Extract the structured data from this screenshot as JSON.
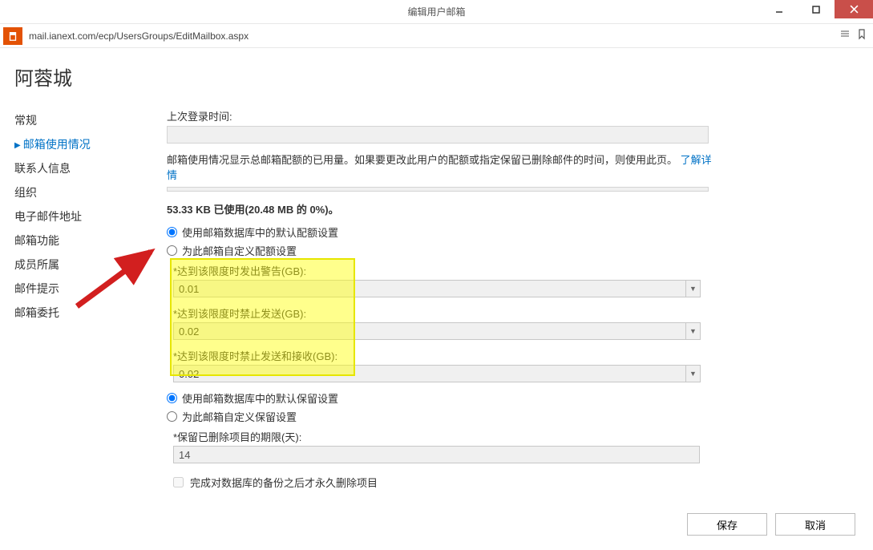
{
  "window": {
    "title": "编辑用户邮箱"
  },
  "addressbar": {
    "url": "mail.ianext.com/ecp/UsersGroups/EditMailbox.aspx"
  },
  "heading": "阿蓉城",
  "nav": {
    "items": [
      {
        "label": "常规"
      },
      {
        "label": "邮箱使用情况"
      },
      {
        "label": "联系人信息"
      },
      {
        "label": "组织"
      },
      {
        "label": "电子邮件地址"
      },
      {
        "label": "邮箱功能"
      },
      {
        "label": "成员所属"
      },
      {
        "label": "邮件提示"
      },
      {
        "label": "邮箱委托"
      }
    ],
    "active_index": 1
  },
  "main": {
    "last_login_label": "上次登录时间:",
    "description_text": "邮箱使用情况显示总邮箱配额的已用量。如果要更改此用户的配额或指定保留已删除邮件的时间，则使用此页。",
    "learn_more": "了解详情",
    "usage_text": "53.33 KB 已使用(20.48 MB 的 0%)。",
    "quota_radio_default": "使用邮箱数据库中的默认配额设置",
    "quota_radio_custom": "为此邮箱自定义配额设置",
    "quota_fields": {
      "warn_label": "*达到该限度时发出警告(GB):",
      "warn_value": "0.01",
      "prohibit_send_label": "*达到该限度时禁止发送(GB):",
      "prohibit_send_value": "0.02",
      "prohibit_sr_label": "*达到该限度时禁止发送和接收(GB):",
      "prohibit_sr_value": "0.02"
    },
    "retention_radio_default": "使用邮箱数据库中的默认保留设置",
    "retention_radio_custom": "为此邮箱自定义保留设置",
    "retention_label": "*保留已删除项目的期限(天):",
    "retention_value": "14",
    "checkbox_label": "完成对数据库的备份之后才永久删除项目"
  },
  "footer": {
    "save": "保存",
    "cancel": "取消"
  }
}
